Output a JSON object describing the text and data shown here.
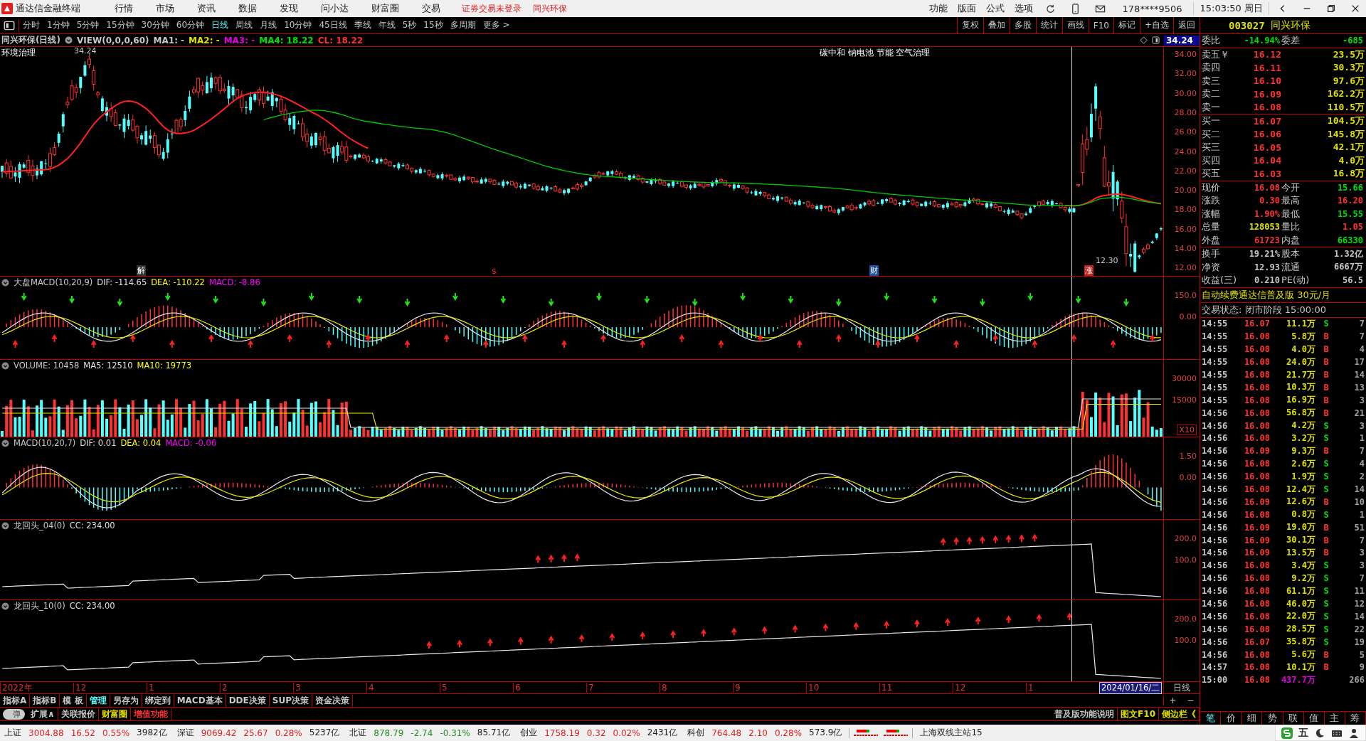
{
  "title_bar": {
    "app_name": "通达信金融终端",
    "menus": [
      "行情",
      "市场",
      "资讯",
      "数据",
      "发现",
      "问小达",
      "财富圈",
      "交易"
    ],
    "notice": "证券交易未登录",
    "stock": "同兴环保",
    "tools": [
      "功能",
      "版面",
      "公式",
      "选项"
    ],
    "account": "178****9506",
    "clock": "15:03:50 周日"
  },
  "periods": [
    {
      "label": "分时",
      "selected": false
    },
    {
      "label": "1分钟",
      "selected": false
    },
    {
      "label": "5分钟",
      "selected": false
    },
    {
      "label": "15分钟",
      "selected": false
    },
    {
      "label": "30分钟",
      "selected": false
    },
    {
      "label": "60分钟",
      "selected": false
    },
    {
      "label": "日线",
      "selected": true
    },
    {
      "label": "周线",
      "selected": false
    },
    {
      "label": "月线",
      "selected": false
    },
    {
      "label": "10分钟",
      "selected": false
    },
    {
      "label": "45日线",
      "selected": false
    },
    {
      "label": "季线",
      "selected": false
    },
    {
      "label": "年线",
      "selected": false
    },
    {
      "label": "5秒",
      "selected": false
    },
    {
      "label": "15秒",
      "selected": false
    },
    {
      "label": "多周期",
      "selected": false
    },
    {
      "label": "更多 >",
      "selected": false
    }
  ],
  "chart_tools": [
    "复权",
    "叠加",
    "多股",
    "统计",
    "画线",
    "F10",
    "标记",
    "+自选",
    "返回"
  ],
  "info_line": {
    "name": "同兴环保(日线)",
    "view": "VIEW(0,0,0,60)",
    "items": [
      {
        "text": "MA1: -",
        "kind": "ma1"
      },
      {
        "text": "MA2: -",
        "kind": "ma2"
      },
      {
        "text": "MA3: -",
        "kind": "ma3"
      },
      {
        "text": "MA4: 18.22",
        "kind": "ma4"
      },
      {
        "text": "CL: 18.22",
        "kind": "close"
      }
    ]
  },
  "main_chart": {
    "sector": "环境治理",
    "concepts": "碳中和 钠电池 节能 空气治理",
    "high_label": "34.24",
    "low_label": "12.30",
    "price_badge": "34.24",
    "axis": [
      "34.00",
      "32.00",
      "30.00",
      "28.00",
      "26.00",
      "24.00",
      "22.00",
      "20.00",
      "18.00",
      "16.00",
      "14.00",
      "12.00"
    ],
    "events": [
      "解",
      "$",
      "财",
      "涨"
    ]
  },
  "indicators": [
    {
      "kind": "macd",
      "title": "大盘MACD(10,20,9)",
      "values": [
        {
          "text": "DIF: -114.65",
          "color": "#e0e0e0"
        },
        {
          "text": "DEA: -110.22",
          "color": "#ffff00"
        },
        {
          "text": "MACD: -8.86",
          "color": "#ff00ff"
        }
      ],
      "axis": [
        "150.0",
        "0.00"
      ]
    },
    {
      "kind": "volume",
      "title": "VOLUME: 10458",
      "values": [
        {
          "text": "MA5: 12510",
          "color": "#e0e0e0"
        },
        {
          "text": "MA10: 19773",
          "color": "#ffff00"
        }
      ],
      "axis": [
        "30000",
        "15000"
      ],
      "unit": "X10"
    },
    {
      "kind": "macd2",
      "title": "MACD(10,20,7)",
      "values": [
        {
          "text": "DIF: 0.01",
          "color": "#e0e0e0"
        },
        {
          "text": "DEA: 0.04",
          "color": "#ffff00"
        },
        {
          "text": "MACD: -0.06",
          "color": "#ff00ff"
        }
      ],
      "axis": [
        "1.50",
        "0.00"
      ]
    },
    {
      "kind": "trend",
      "title": "龙回头_04(0)",
      "values": [
        {
          "text": "CC: 234.00",
          "color": "#e0e0e0"
        }
      ],
      "axis": [
        "200.0",
        "100.0"
      ]
    },
    {
      "kind": "trend2",
      "title": "龙回头_10(0)",
      "values": [
        {
          "text": "CC: 234.00",
          "color": "#e0e0e0"
        }
      ],
      "axis": [
        "200.0",
        "100.0"
      ]
    }
  ],
  "date_axis": {
    "labels": [
      "2022年",
      "12",
      "1",
      "2",
      "3",
      "4",
      "5",
      "6",
      "7",
      "8",
      "9",
      "10",
      "11",
      "12",
      "1"
    ],
    "cursor_date": "2024/01/16/二",
    "period": "日线",
    "zoom_in": "+",
    "zoom_out": "−"
  },
  "bottom_tabs": [
    {
      "label": "指标A",
      "selected": false
    },
    {
      "label": "指标B",
      "selected": false
    },
    {
      "label": "模 板",
      "selected": false
    },
    {
      "label": "管理",
      "selected": true
    },
    {
      "label": "另存为",
      "selected": false
    },
    {
      "label": "绑定到",
      "selected": false
    },
    {
      "label": "MACD基本",
      "selected": false
    },
    {
      "label": "DDE决策",
      "selected": false
    },
    {
      "label": "SUP决策",
      "selected": false
    },
    {
      "label": "资金决策",
      "selected": false
    }
  ],
  "bottom_tabs2": {
    "toggle": "弹",
    "items": [
      {
        "label": "扩展∧",
        "color": "#c8c8c8"
      },
      {
        "label": "关联报价",
        "color": "#c8c8c8"
      },
      {
        "label": "财富圈",
        "color": "#e0e000"
      },
      {
        "label": "增值功能",
        "color": "#ff3232"
      }
    ],
    "right": [
      {
        "label": "普及版功能说明",
        "color": "#c8c8c8"
      },
      {
        "label": "图文F10",
        "color": "#e0e000"
      },
      {
        "label": "侧边栏《",
        "color": "#e0e000"
      }
    ]
  },
  "quote": {
    "code": "003027",
    "name": "同兴环保",
    "ratio_label": "委比",
    "ratio": "-14.94%",
    "diff_label": "委差",
    "diff": "-685",
    "asks": [
      {
        "label": "卖五",
        "mark": "￥",
        "price": "16.12",
        "volume": "23.5万"
      },
      {
        "label": "卖四",
        "price": "16.11",
        "volume": "30.3万"
      },
      {
        "label": "卖三",
        "price": "16.10",
        "volume": "97.6万"
      },
      {
        "label": "卖二",
        "price": "16.09",
        "volume": "162.2万"
      },
      {
        "label": "卖一",
        "price": "16.08",
        "volume": "110.5万"
      }
    ],
    "bids": [
      {
        "label": "买一",
        "price": "16.07",
        "volume": "104.5万"
      },
      {
        "label": "买二",
        "price": "16.06",
        "volume": "145.8万"
      },
      {
        "label": "买三",
        "price": "16.05",
        "volume": "42.1万"
      },
      {
        "label": "买四",
        "price": "16.04",
        "volume": "4.0万"
      },
      {
        "label": "买五",
        "price": "16.03",
        "volume": "16.8万"
      }
    ],
    "stats": [
      [
        {
          "label": "现价",
          "value": "16.08",
          "color": "#ff3232"
        },
        {
          "label": "今开",
          "value": "15.66",
          "color": "#00e000"
        }
      ],
      [
        {
          "label": "涨跌",
          "value": "0.30",
          "color": "#ff3232"
        },
        {
          "label": "最高",
          "value": "16.20",
          "color": "#ff3232"
        }
      ],
      [
        {
          "label": "涨幅",
          "value": "1.90%",
          "color": "#ff3232"
        },
        {
          "label": "最低",
          "value": "15.55",
          "color": "#00e000"
        }
      ],
      [
        {
          "label": "总量",
          "value": "128053",
          "color": "#e0e000"
        },
        {
          "label": "量比",
          "value": "1.05",
          "color": "#ff3232"
        }
      ],
      [
        {
          "label": "外盘",
          "value": "61723",
          "color": "#ff3232"
        },
        {
          "label": "内盘",
          "value": "66330",
          "color": "#00e000"
        }
      ]
    ],
    "fundamentals": [
      [
        {
          "label": "换手",
          "value": "19.21%"
        },
        {
          "label": "股本",
          "value": "1.32亿"
        }
      ],
      [
        {
          "label": "净资",
          "value": "12.93"
        },
        {
          "label": "流通",
          "value": "6667万"
        }
      ],
      [
        {
          "label": "收益(三)",
          "value": "0.210"
        },
        {
          "label": "PE(动)",
          "value": "56.5"
        }
      ]
    ],
    "ad": "自动续费通达信普及版  30元/月",
    "status": "交易状态: 闭市阶段 15:00:00"
  },
  "trades": [
    {
      "time": "14:55",
      "price": "16.07",
      "volume": "11.1万",
      "side": "S",
      "buy": false,
      "count": "7"
    },
    {
      "time": "14:55",
      "price": "16.08",
      "volume": "5.8万",
      "side": "B",
      "buy": true,
      "count": "7"
    },
    {
      "time": "14:55",
      "price": "16.08",
      "volume": "4.0万",
      "side": "B",
      "buy": true,
      "count": "4"
    },
    {
      "time": "14:55",
      "price": "16.08",
      "volume": "24.0万",
      "side": "B",
      "buy": true,
      "count": "17"
    },
    {
      "time": "14:55",
      "price": "16.08",
      "volume": "21.7万",
      "side": "B",
      "buy": true,
      "count": "14"
    },
    {
      "time": "14:55",
      "price": "16.08",
      "volume": "10.3万",
      "side": "B",
      "buy": true,
      "count": "13"
    },
    {
      "time": "14:55",
      "price": "16.08",
      "volume": "16.9万",
      "side": "B",
      "buy": true,
      "count": "3"
    },
    {
      "time": "14:56",
      "price": "16.08",
      "volume": "56.8万",
      "side": "B",
      "buy": true,
      "count": "21"
    },
    {
      "time": "14:56",
      "price": "16.08",
      "volume": "4.2万",
      "side": "S",
      "buy": false,
      "count": "3"
    },
    {
      "time": "14:56",
      "price": "16.08",
      "volume": "3.2万",
      "side": "S",
      "buy": false,
      "count": "1"
    },
    {
      "time": "14:56",
      "price": "16.09",
      "volume": "9.3万",
      "side": "B",
      "buy": true,
      "count": "7"
    },
    {
      "time": "14:56",
      "price": "16.08",
      "volume": "2.6万",
      "side": "S",
      "buy": false,
      "count": "4"
    },
    {
      "time": "14:56",
      "price": "16.08",
      "volume": "1.9万",
      "side": "S",
      "buy": false,
      "count": "2"
    },
    {
      "time": "14:56",
      "price": "16.08",
      "volume": "12.4万",
      "side": "S",
      "buy": false,
      "count": "14"
    },
    {
      "time": "14:56",
      "price": "16.09",
      "volume": "12.6万",
      "side": "B",
      "buy": true,
      "count": "10"
    },
    {
      "time": "14:56",
      "price": "16.08",
      "volume": "0.8万",
      "side": "S",
      "buy": false,
      "count": "1"
    },
    {
      "time": "14:56",
      "price": "16.09",
      "volume": "19.0万",
      "side": "B",
      "buy": true,
      "count": "51"
    },
    {
      "time": "14:56",
      "price": "16.09",
      "volume": "30.1万",
      "side": "B",
      "buy": true,
      "count": "7"
    },
    {
      "time": "14:56",
      "price": "16.09",
      "volume": "13.5万",
      "side": "B",
      "buy": true,
      "count": "3"
    },
    {
      "time": "14:56",
      "price": "16.08",
      "volume": "3.4万",
      "side": "S",
      "buy": false,
      "count": "3"
    },
    {
      "time": "14:56",
      "price": "16.08",
      "volume": "9.2万",
      "side": "S",
      "buy": false,
      "count": "7"
    },
    {
      "time": "14:56",
      "price": "16.08",
      "volume": "61.1万",
      "side": "S",
      "buy": false,
      "count": "11"
    },
    {
      "time": "14:56",
      "price": "16.08",
      "volume": "46.0万",
      "side": "S",
      "buy": false,
      "count": "12"
    },
    {
      "time": "14:56",
      "price": "16.08",
      "volume": "22.0万",
      "side": "S",
      "buy": false,
      "count": "14"
    },
    {
      "time": "14:56",
      "price": "16.08",
      "volume": "28.5万",
      "side": "S",
      "buy": false,
      "count": "22"
    },
    {
      "time": "14:56",
      "price": "16.07",
      "volume": "35.8万",
      "side": "S",
      "buy": false,
      "count": "19"
    },
    {
      "time": "14:56",
      "price": "16.08",
      "volume": "5.6万",
      "side": "B",
      "buy": true,
      "count": "5"
    },
    {
      "time": "14:57",
      "price": "16.08",
      "volume": "10.1万",
      "side": "B",
      "buy": true,
      "count": "9"
    },
    {
      "time": "15:00",
      "price": "16.08",
      "volume": "437.7万",
      "kind": "total",
      "count": "266"
    }
  ],
  "side_tabs": [
    {
      "label": "笔",
      "selected": true
    },
    {
      "label": "价",
      "selected": false
    },
    {
      "label": "细",
      "selected": false
    },
    {
      "label": "势",
      "selected": false
    },
    {
      "label": "联",
      "selected": false
    },
    {
      "label": "值",
      "selected": false
    },
    {
      "label": "主",
      "selected": false
    },
    {
      "label": "筹",
      "selected": false
    }
  ],
  "indices": [
    {
      "name": "上证",
      "value": "3004.88",
      "change": "16.52",
      "pct": "0.55%",
      "amount": "3982亿",
      "up": true
    },
    {
      "name": "深证",
      "value": "9069.42",
      "change": "25.67",
      "pct": "0.28%",
      "amount": "5237亿",
      "up": true
    },
    {
      "name": "北证",
      "value": "878.79",
      "change": "-2.74",
      "pct": "-0.31%",
      "amount": "85.71亿",
      "up": false
    },
    {
      "name": "创业",
      "value": "1758.19",
      "change": "0.32",
      "pct": "0.02%",
      "amount": "2431亿",
      "up": true
    },
    {
      "name": "科创",
      "value": "764.48",
      "change": "2.10",
      "pct": "0.28%",
      "amount": "573.9亿",
      "up": true
    }
  ],
  "server": "上海双线主站15",
  "ime": "五"
}
